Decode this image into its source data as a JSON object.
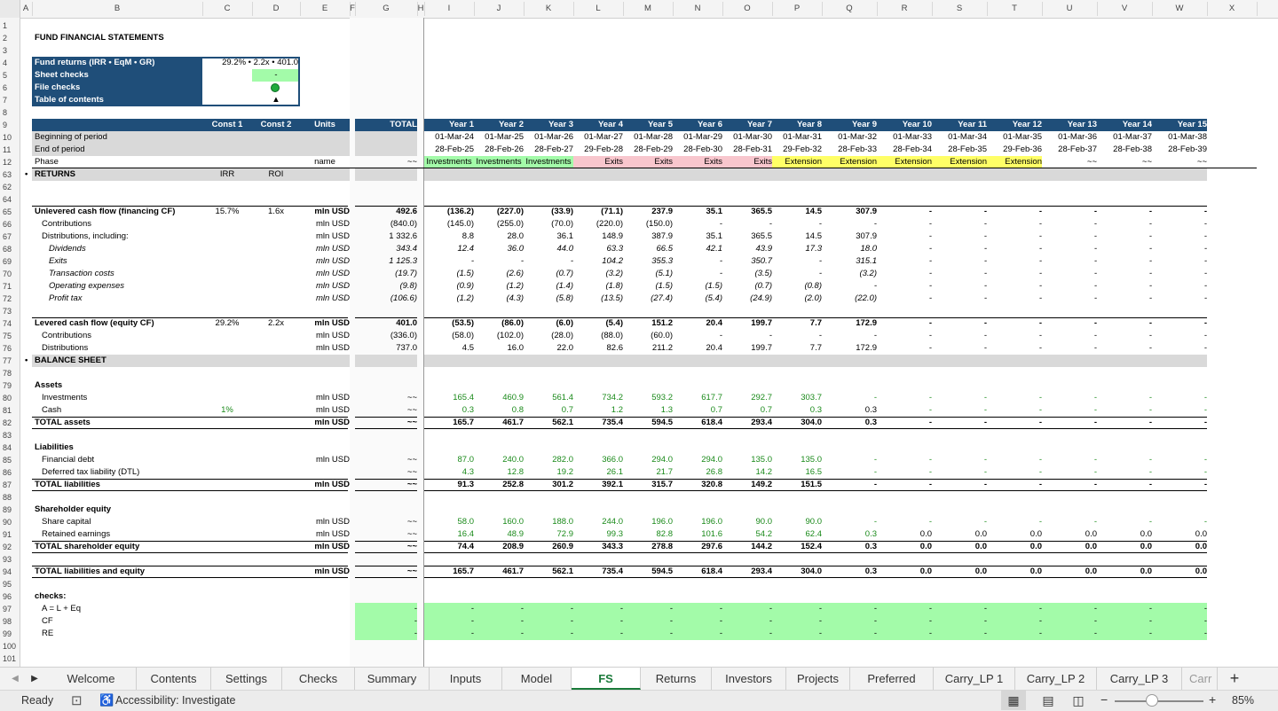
{
  "columns": [
    "A",
    "B",
    "C",
    "D",
    "E",
    "F",
    "G",
    "H",
    "I",
    "J",
    "K",
    "L",
    "M",
    "N",
    "O",
    "P",
    "Q",
    "R",
    "S",
    "T",
    "U",
    "V",
    "W",
    "X"
  ],
  "rows": {
    "top": [
      "1",
      "2",
      "3",
      "4",
      "5",
      "6",
      "7",
      "8",
      "9",
      "10",
      "11",
      "12"
    ],
    "body": [
      "63",
      "62",
      "64",
      "65",
      "66",
      "67",
      "68",
      "69",
      "70",
      "71",
      "72",
      "73",
      "74",
      "75",
      "76",
      "77",
      "78",
      "79",
      "80",
      "81",
      "82",
      "83",
      "84",
      "85",
      "86",
      "87",
      "88",
      "89",
      "90",
      "91",
      "92",
      "93",
      "94",
      "95",
      "96",
      "97",
      "98",
      "99",
      "100",
      "101"
    ]
  },
  "title": "FUND FINANCIAL STATEMENTS",
  "summary_box": {
    "rows": [
      {
        "label": "Fund returns (IRR • EqM • GR)",
        "value": "29.2% • 2.2x • 401.0"
      },
      {
        "label": "Sheet checks",
        "value": "-"
      },
      {
        "label": "File checks",
        "value": "●"
      },
      {
        "label": "Table of contents",
        "value": "▲"
      }
    ]
  },
  "header": {
    "const1": "Const 1",
    "const2": "Const 2",
    "units": "Units",
    "total": "TOTAL",
    "years": [
      "Year 1",
      "Year 2",
      "Year 3",
      "Year 4",
      "Year 5",
      "Year 6",
      "Year 7",
      "Year 8",
      "Year 9",
      "Year 10",
      "Year 11",
      "Year 12",
      "Year 13",
      "Year 14",
      "Year 15"
    ],
    "begin_label": "Beginning of period",
    "end_label": "End of period",
    "phase_label": "Phase",
    "phase_units": "name",
    "phase_total": "~~",
    "begin": [
      "01-Mar-24",
      "01-Mar-25",
      "01-Mar-26",
      "01-Mar-27",
      "01-Mar-28",
      "01-Mar-29",
      "01-Mar-30",
      "01-Mar-31",
      "01-Mar-32",
      "01-Mar-33",
      "01-Mar-34",
      "01-Mar-35",
      "01-Mar-36",
      "01-Mar-37",
      "01-Mar-38"
    ],
    "end": [
      "28-Feb-25",
      "28-Feb-26",
      "28-Feb-27",
      "29-Feb-28",
      "28-Feb-29",
      "28-Feb-30",
      "28-Feb-31",
      "29-Feb-32",
      "28-Feb-33",
      "28-Feb-34",
      "28-Feb-35",
      "29-Feb-36",
      "28-Feb-37",
      "28-Feb-38",
      "28-Feb-39"
    ],
    "phase": [
      "Investments",
      "Investments",
      "Investments",
      "Exits",
      "Exits",
      "Exits",
      "Exits",
      "Extension",
      "Extension",
      "Extension",
      "Extension",
      "Extension",
      "~~",
      "~~",
      "~~"
    ]
  },
  "returns": {
    "section": "RETURNS",
    "c1": "IRR",
    "c2": "ROI",
    "rows": [
      {
        "label": "Unlevered cash flow (financing CF)",
        "c1": "15.7%",
        "c2": "1.6x",
        "units": "mln USD",
        "total": "492.6",
        "vals": [
          "(136.2)",
          "(227.0)",
          "(33.9)",
          "(71.1)",
          "237.9",
          "35.1",
          "365.5",
          "14.5",
          "307.9",
          "-",
          "-",
          "-",
          "-",
          "-",
          "-"
        ]
      },
      {
        "label": "Contributions",
        "c1": "",
        "c2": "",
        "units": "mln USD",
        "total": "(840.0)",
        "vals": [
          "(145.0)",
          "(255.0)",
          "(70.0)",
          "(220.0)",
          "(150.0)",
          "-",
          "-",
          "-",
          "-",
          "-",
          "-",
          "-",
          "-",
          "-",
          "-"
        ]
      },
      {
        "label": "Distributions, including:",
        "c1": "",
        "c2": "",
        "units": "mln USD",
        "total": "1 332.6",
        "vals": [
          "8.8",
          "28.0",
          "36.1",
          "148.9",
          "387.9",
          "35.1",
          "365.5",
          "14.5",
          "307.9",
          "-",
          "-",
          "-",
          "-",
          "-",
          "-"
        ]
      },
      {
        "label": "Dividends",
        "c1": "",
        "c2": "",
        "units": "mln USD",
        "total": "343.4",
        "vals": [
          "12.4",
          "36.0",
          "44.0",
          "63.3",
          "66.5",
          "42.1",
          "43.9",
          "17.3",
          "18.0",
          "-",
          "-",
          "-",
          "-",
          "-",
          "-"
        ]
      },
      {
        "label": "Exits",
        "c1": "",
        "c2": "",
        "units": "mln USD",
        "total": "1 125.3",
        "vals": [
          "-",
          "-",
          "-",
          "104.2",
          "355.3",
          "-",
          "350.7",
          "-",
          "315.1",
          "-",
          "-",
          "-",
          "-",
          "-",
          "-"
        ]
      },
      {
        "label": "Transaction costs",
        "c1": "",
        "c2": "",
        "units": "mln USD",
        "total": "(19.7)",
        "vals": [
          "(1.5)",
          "(2.6)",
          "(0.7)",
          "(3.2)",
          "(5.1)",
          "-",
          "(3.5)",
          "-",
          "(3.2)",
          "-",
          "-",
          "-",
          "-",
          "-",
          "-"
        ]
      },
      {
        "label": "Operating expenses",
        "c1": "",
        "c2": "",
        "units": "mln USD",
        "total": "(9.8)",
        "vals": [
          "(0.9)",
          "(1.2)",
          "(1.4)",
          "(1.8)",
          "(1.5)",
          "(1.5)",
          "(0.7)",
          "(0.8)",
          "-",
          "-",
          "-",
          "-",
          "-",
          "-",
          "-"
        ]
      },
      {
        "label": "Profit tax",
        "c1": "",
        "c2": "",
        "units": "mln USD",
        "total": "(106.6)",
        "vals": [
          "(1.2)",
          "(4.3)",
          "(5.8)",
          "(13.5)",
          "(27.4)",
          "(5.4)",
          "(24.9)",
          "(2.0)",
          "(22.0)",
          "-",
          "-",
          "-",
          "-",
          "-",
          "-"
        ]
      },
      {
        "label": "",
        "c1": "",
        "c2": "",
        "units": "",
        "total": "",
        "vals": []
      },
      {
        "label": "Levered cash flow (equity CF)",
        "c1": "29.2%",
        "c2": "2.2x",
        "units": "mln USD",
        "total": "401.0",
        "vals": [
          "(53.5)",
          "(86.0)",
          "(6.0)",
          "(5.4)",
          "151.2",
          "20.4",
          "199.7",
          "7.7",
          "172.9",
          "-",
          "-",
          "-",
          "-",
          "-",
          "-"
        ]
      },
      {
        "label": "Contributions",
        "c1": "",
        "c2": "",
        "units": "mln USD",
        "total": "(336.0)",
        "vals": [
          "(58.0)",
          "(102.0)",
          "(28.0)",
          "(88.0)",
          "(60.0)",
          "-",
          "-",
          "-",
          "-",
          "-",
          "-",
          "-",
          "-",
          "-",
          "-"
        ]
      },
      {
        "label": "Distributions",
        "c1": "",
        "c2": "",
        "units": "mln USD",
        "total": "737.0",
        "vals": [
          "4.5",
          "16.0",
          "22.0",
          "82.6",
          "211.2",
          "20.4",
          "199.7",
          "7.7",
          "172.9",
          "-",
          "-",
          "-",
          "-",
          "-",
          "-"
        ]
      }
    ]
  },
  "balance": {
    "section": "BALANCE SHEET",
    "rows": [
      {
        "label": "",
        "units": "",
        "total": "",
        "vals": []
      },
      {
        "label": "Assets",
        "units": "",
        "total": "",
        "vals": []
      },
      {
        "label": "Investments",
        "c1": "",
        "units": "mln USD",
        "total": "~~",
        "vals": [
          "165.4",
          "460.9",
          "561.4",
          "734.2",
          "593.2",
          "617.7",
          "292.7",
          "303.7",
          "-",
          "-",
          "-",
          "-",
          "-",
          "-",
          "-"
        ]
      },
      {
        "label": "Cash",
        "c1": "1%",
        "units": "mln USD",
        "total": "~~",
        "vals": [
          "0.3",
          "0.8",
          "0.7",
          "1.2",
          "1.3",
          "0.7",
          "0.7",
          "0.3",
          "0.3",
          "-",
          "-",
          "-",
          "-",
          "-",
          "-"
        ]
      },
      {
        "label": "TOTAL assets",
        "units": "mln USD",
        "total": "~~",
        "vals": [
          "165.7",
          "461.7",
          "562.1",
          "735.4",
          "594.5",
          "618.4",
          "293.4",
          "304.0",
          "0.3",
          "-",
          "-",
          "-",
          "-",
          "-",
          "-"
        ]
      },
      {
        "label": "",
        "units": "",
        "total": "",
        "vals": []
      },
      {
        "label": "Liabilities",
        "units": "",
        "total": "",
        "vals": []
      },
      {
        "label": "Financial debt",
        "units": "mln USD",
        "total": "~~",
        "vals": [
          "87.0",
          "240.0",
          "282.0",
          "366.0",
          "294.0",
          "294.0",
          "135.0",
          "135.0",
          "-",
          "-",
          "-",
          "-",
          "-",
          "-",
          "-"
        ]
      },
      {
        "label": "Deferred tax liability (DTL)",
        "units": "",
        "total": "~~",
        "vals": [
          "4.3",
          "12.8",
          "19.2",
          "26.1",
          "21.7",
          "26.8",
          "14.2",
          "16.5",
          "-",
          "-",
          "-",
          "-",
          "-",
          "-",
          "-"
        ]
      },
      {
        "label": "TOTAL liabilities",
        "units": "mln USD",
        "total": "~~",
        "vals": [
          "91.3",
          "252.8",
          "301.2",
          "392.1",
          "315.7",
          "320.8",
          "149.2",
          "151.5",
          "-",
          "-",
          "-",
          "-",
          "-",
          "-",
          "-"
        ]
      },
      {
        "label": "",
        "units": "",
        "total": "",
        "vals": []
      },
      {
        "label": "Shareholder equity",
        "units": "",
        "total": "",
        "vals": []
      },
      {
        "label": "Share capital",
        "units": "mln USD",
        "total": "~~",
        "vals": [
          "58.0",
          "160.0",
          "188.0",
          "244.0",
          "196.0",
          "196.0",
          "90.0",
          "90.0",
          "-",
          "-",
          "-",
          "-",
          "-",
          "-",
          "-"
        ]
      },
      {
        "label": "Retained earnings",
        "units": "mln USD",
        "total": "~~",
        "vals": [
          "16.4",
          "48.9",
          "72.9",
          "99.3",
          "82.8",
          "101.6",
          "54.2",
          "62.4",
          "0.3",
          "0.0",
          "0.0",
          "0.0",
          "0.0",
          "0.0",
          "0.0"
        ]
      },
      {
        "label": "TOTAL shareholder equity",
        "units": "mln USD",
        "total": "~~",
        "vals": [
          "74.4",
          "208.9",
          "260.9",
          "343.3",
          "278.8",
          "297.6",
          "144.2",
          "152.4",
          "0.3",
          "0.0",
          "0.0",
          "0.0",
          "0.0",
          "0.0",
          "0.0"
        ]
      },
      {
        "label": "",
        "units": "",
        "total": "",
        "vals": []
      },
      {
        "label": "TOTAL liabilities and equity",
        "units": "mln USD",
        "total": "~~",
        "vals": [
          "165.7",
          "461.7",
          "562.1",
          "735.4",
          "594.5",
          "618.4",
          "293.4",
          "304.0",
          "0.3",
          "0.0",
          "0.0",
          "0.0",
          "0.0",
          "0.0",
          "0.0"
        ]
      },
      {
        "label": "",
        "units": "",
        "total": "",
        "vals": []
      },
      {
        "label": "checks:",
        "units": "",
        "total": "",
        "vals": []
      },
      {
        "label": "A = L + Eq",
        "units": "",
        "total": "-",
        "vals": [
          "-",
          "-",
          "-",
          "-",
          "-",
          "-",
          "-",
          "-",
          "-",
          "-",
          "-",
          "-",
          "-",
          "-",
          "-"
        ]
      },
      {
        "label": "CF",
        "units": "",
        "total": "-",
        "vals": [
          "-",
          "-",
          "-",
          "-",
          "-",
          "-",
          "-",
          "-",
          "-",
          "-",
          "-",
          "-",
          "-",
          "-",
          "-"
        ]
      },
      {
        "label": "RE",
        "units": "",
        "total": "-",
        "vals": [
          "-",
          "-",
          "-",
          "-",
          "-",
          "-",
          "-",
          "-",
          "-",
          "-",
          "-",
          "-",
          "-",
          "-",
          "-"
        ]
      }
    ]
  },
  "tabs": [
    "Welcome",
    "Contents",
    "Settings",
    "Checks",
    "Summary",
    "Inputs",
    "Model",
    "FS",
    "Returns",
    "Investors",
    "Projects",
    "Preferred",
    "Carry_LP 1",
    "Carry_LP 2",
    "Carry_LP 3",
    "Carr"
  ],
  "active_tab": "FS",
  "status": {
    "ready": "Ready",
    "accessibility": "Accessibility: Investigate",
    "zoom": "85%"
  },
  "colors": {
    "header_blue": "#1f4e79",
    "green_fill": "#a3fba9",
    "red_fill": "#f8c6cd",
    "yellow_fill": "#ffff66",
    "active_tab_green": "#1a7a3a"
  }
}
